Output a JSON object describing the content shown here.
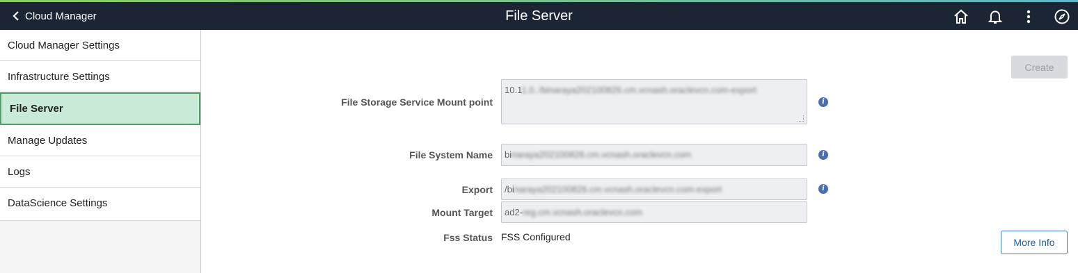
{
  "header": {
    "back_label": "Cloud Manager",
    "title": "File Server",
    "icons": [
      "home-icon",
      "bell-icon",
      "more-vertical-icon",
      "compass-icon"
    ]
  },
  "sidebar": {
    "items": [
      {
        "label": "Cloud Manager Settings"
      },
      {
        "label": "Infrastructure Settings"
      },
      {
        "label": "File Server",
        "active": true
      },
      {
        "label": "Manage Updates"
      },
      {
        "label": "Logs"
      },
      {
        "label": "DataScience Settings"
      }
    ]
  },
  "main": {
    "create_label": "Create",
    "more_info_label": "More Info",
    "fields": {
      "mount_point": {
        "label": "File Storage Service Mount point",
        "value_visible": "10.1",
        "value_blurred": "1.0.:/binaraya202100826.cm.vcnash.oraclevcn.com-export"
      },
      "fs_name": {
        "label": "File System Name",
        "value_visible": "bi",
        "value_blurred": "naraya202100826.cm.vcnash.oraclevcn.com"
      },
      "export": {
        "label": "Export",
        "value_visible": "/bi",
        "value_blurred": "naraya202100826.cm.vcnash.oraclevcn.com-export"
      },
      "mount_target": {
        "label": "Mount Target",
        "value_visible": "ad2-",
        "value_blurred": "reg.cm.vcnash.oraclevcn.com"
      },
      "fss_status": {
        "label": "Fss Status",
        "value": "FSS Configured"
      }
    }
  },
  "colors": {
    "topbar": "#1c2533",
    "active_nav_bg": "#c9ead6",
    "active_nav_border": "#4d9e6a",
    "info_icon": "#4a6fb0",
    "link_blue": "#1f5fa8"
  }
}
